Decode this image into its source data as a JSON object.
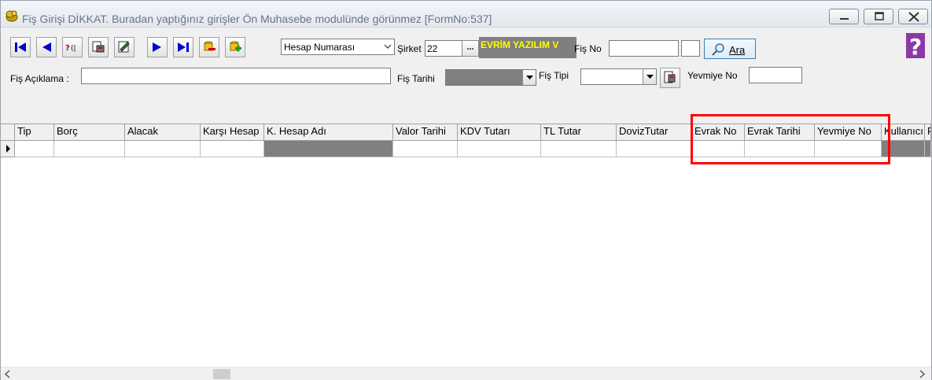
{
  "window": {
    "title": "Fiş Girişi DİKKAT. Buradan yaptığınız girişler Ön Muhasebe modulünde görünmez [FormNo:537]"
  },
  "toolbar": {
    "search_field_select": "Hesap Numarası",
    "sirket_label": "Şirket",
    "sirket_value": "22",
    "sirket_browse": "...",
    "company_name": "EVRİM YAZILIM  V",
    "fis_no_label": "Fiş No",
    "fis_no_value": "",
    "ara_label": "Ara",
    "help_glyph": "?"
  },
  "form": {
    "fis_aciklama_label": "Fiş Açıklama :",
    "fis_tarihi_label": "Fiş Tarihi",
    "fis_tipi_label": "Fiş  Tipi",
    "yevmiye_no_label": "Yevmiye No"
  },
  "grid": {
    "columns": [
      "Tip",
      "Borç",
      "Alacak",
      "Karşı Hesap",
      "K. Hesap Adı",
      "Valor Tarihi",
      "KDV Tutarı",
      "TL Tutar",
      "DovizTutar",
      "Evrak No",
      "Evrak Tarihi",
      "Yevmiye No",
      "Kullanıcı",
      "F"
    ],
    "rows": [
      [
        "",
        "",
        "",
        "",
        "",
        "",
        "",
        "",
        "",
        "",
        "",
        "",
        "",
        ""
      ]
    ]
  },
  "colors": {
    "highlight": "#ff0000",
    "company_text": "#ffff00",
    "company_bg": "#7f7f7f"
  }
}
